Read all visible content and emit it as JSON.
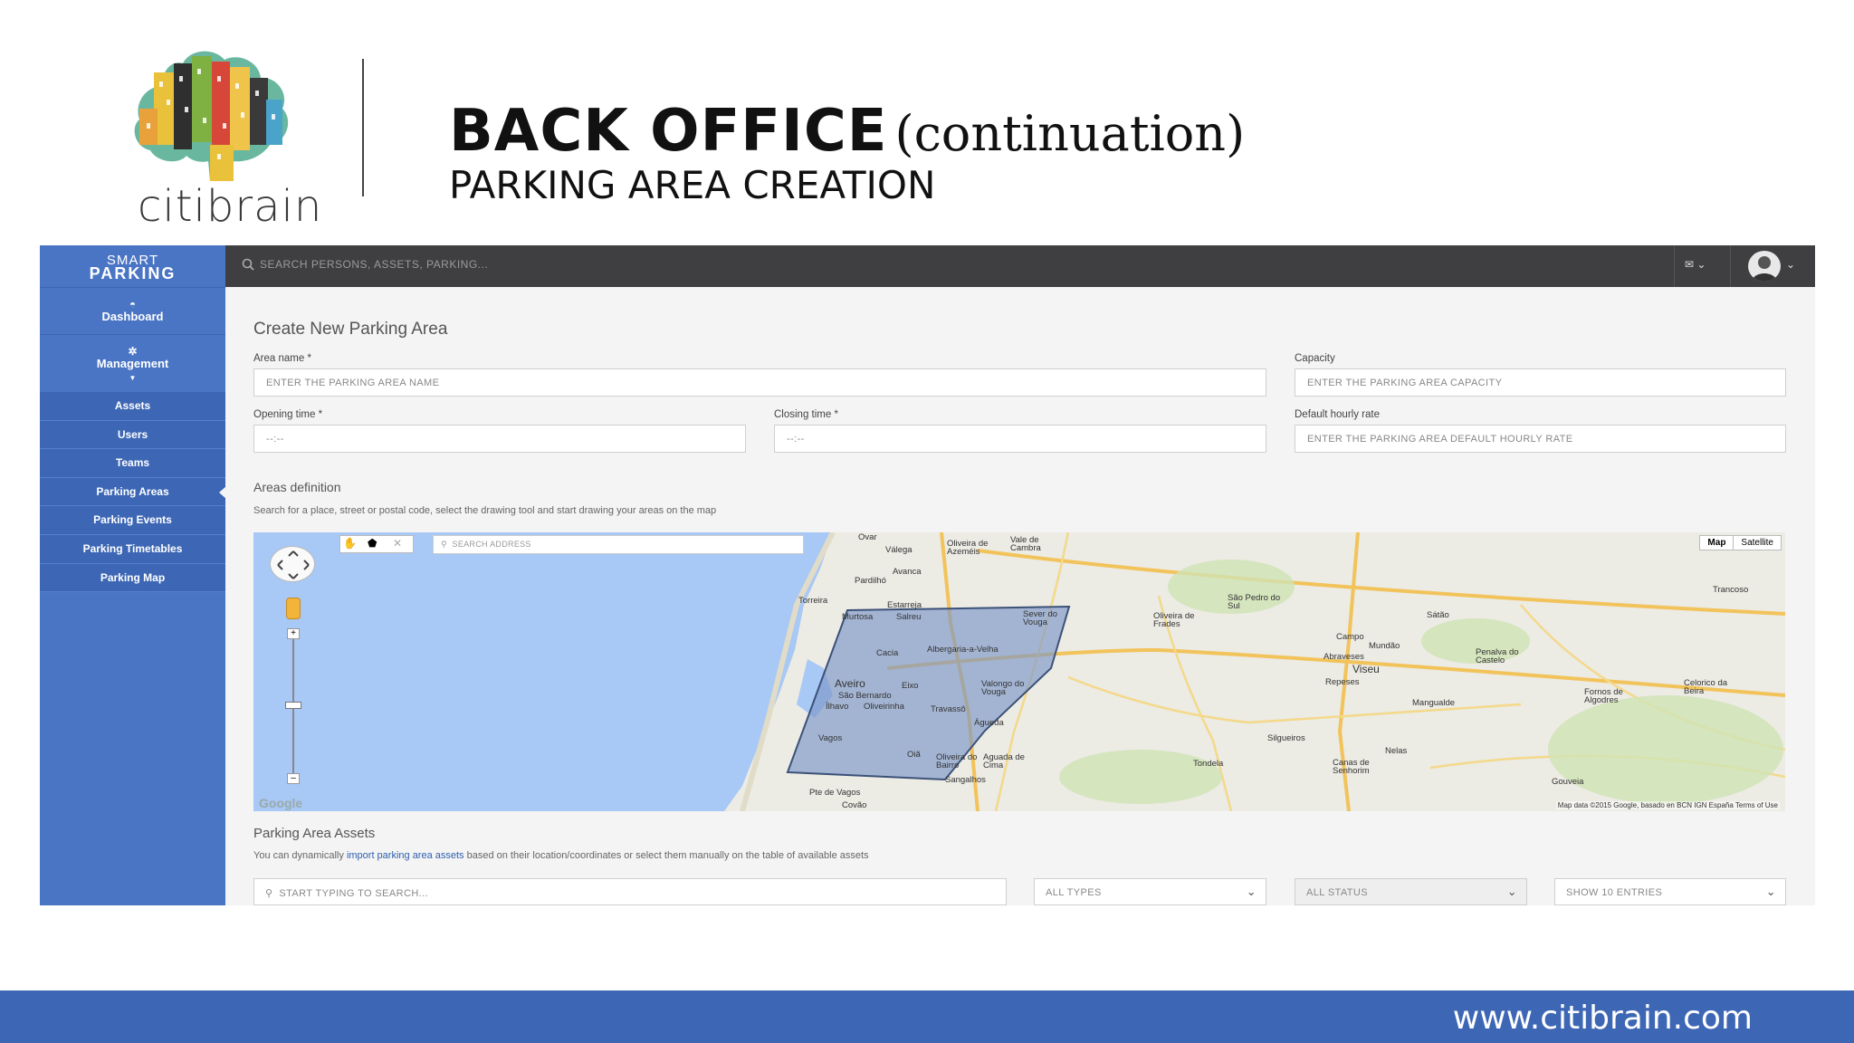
{
  "slide": {
    "logo_text": "citibrain",
    "title_bold": "BACK OFFICE",
    "title_paren": "(continuation)",
    "subtitle": "PARKING AREA CREATION",
    "footer_url": "www.citibrain.com"
  },
  "sidebar": {
    "brand_top": "SMART",
    "brand_bottom": "PARKING",
    "dashboard": "Dashboard",
    "management": "Management",
    "items": [
      {
        "label": "Assets"
      },
      {
        "label": "Users"
      },
      {
        "label": "Teams"
      },
      {
        "label": "Parking Areas"
      },
      {
        "label": "Parking Events"
      },
      {
        "label": "Parking Timetables"
      },
      {
        "label": "Parking Map"
      }
    ]
  },
  "topbar": {
    "search_placeholder": "SEARCH PERSONS, ASSETS, PARKING..."
  },
  "form": {
    "heading": "Create New Parking Area",
    "area_name_label": "Area name",
    "area_name_placeholder": "ENTER THE PARKING AREA NAME",
    "capacity_label": "Capacity",
    "capacity_placeholder": "ENTER THE PARKING AREA CAPACITY",
    "opening_label": "Opening time",
    "opening_value": "--:--",
    "closing_label": "Closing time",
    "closing_value": "--:--",
    "rate_label": "Default hourly rate",
    "rate_placeholder": "ENTER THE PARKING AREA DEFAULT HOURLY RATE",
    "required_mark": "*"
  },
  "areas": {
    "heading": "Areas definition",
    "description": "Search for a place, street or postal code, select the drawing tool and start drawing your areas on the map",
    "map_search_placeholder": "SEARCH ADDRESS",
    "map_type_map": "Map",
    "map_type_satellite": "Satellite",
    "map_footer": "Map data ©2015 Google, basado en BCN IGN España     Terms of Use",
    "google_logo": "Google",
    "places": [
      "Ovar",
      "Válega",
      "Oliveira de Azeméis",
      "Vale de Cambra",
      "Avanca",
      "Pardilhó",
      "Estarreja",
      "Torreira",
      "Murtosa",
      "Salreu",
      "Sever do Vouga",
      "Oliveira de Frades",
      "São Pedro do Sul",
      "Sátão",
      "Trancoso",
      "Campo",
      "Mundão",
      "Abraveses",
      "Viseu",
      "Repeses",
      "Penalva do Castelo",
      "Cacia",
      "Albergaria-a-Velha",
      "Aveiro",
      "Eixo",
      "São Bernardo",
      "Ílhavo",
      "Oliveirinha",
      "Valongo do Vouga",
      "Travassô",
      "Águeda",
      "Mangualde",
      "Fornos de Algodres",
      "Celorico da Beira",
      "Vagos",
      "Oiã",
      "Oliveira do Bairro",
      "Aguada de Cima",
      "Sangalhos",
      "Silgueiros",
      "Nelas",
      "Canas de Senhorim",
      "Tondela",
      "Gouveia",
      "Pte de Vagos",
      "Covão"
    ]
  },
  "assets": {
    "heading": "Parking Area Assets",
    "desc_before": "You can dynamically ",
    "desc_link": "import parking area assets",
    "desc_after": " based on their location/coordinates or select them manually on the table of available assets",
    "search_placeholder": "START TYPING TO SEARCH...",
    "type_select": "ALL TYPES",
    "status_select": "ALL STATUS",
    "entries_select": "SHOW 10 ENTRIES"
  }
}
